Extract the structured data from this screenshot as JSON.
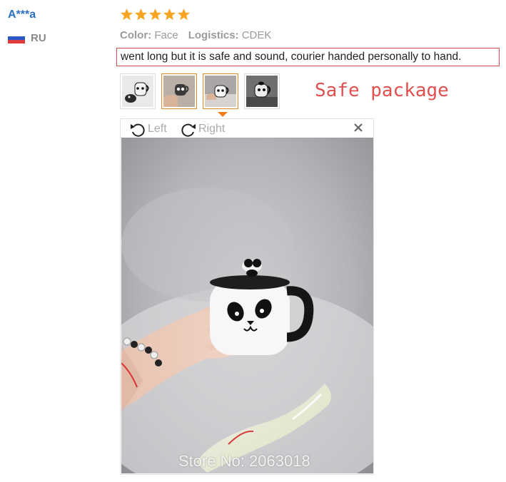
{
  "reviewer": {
    "name": "A***a",
    "country_code": "RU",
    "flag_icon": "russia-flag-icon"
  },
  "rating": {
    "stars": 5,
    "max": 5,
    "star_color": "#f5a623"
  },
  "attributes": {
    "color_label": "Color:",
    "color_value": "Face",
    "logistics_label": "Logistics:",
    "logistics_value": "CDEK"
  },
  "review_text": "went long but it is safe and sound, courier handed personally to hand.",
  "annotation_text": "Safe package",
  "thumbnails": [
    {
      "icon": "panda-mug-thumbnail",
      "active": false
    },
    {
      "icon": "panda-mug-in-hand-thumbnail",
      "active": true
    },
    {
      "icon": "panda-mug-on-fur-thumbnail",
      "active": true
    },
    {
      "icon": "panda-mug-dark-thumbnail",
      "active": false
    }
  ],
  "viewer": {
    "rotate_left_label": "Left",
    "rotate_right_label": "Right",
    "close_icon": "close-icon",
    "watermark": "Store No: 2063018"
  },
  "colors": {
    "name_blue": "#2b6fc4",
    "highlight_red": "#d94a4a",
    "annotation_red": "#e0504f",
    "active_orange": "#e08a2e"
  }
}
